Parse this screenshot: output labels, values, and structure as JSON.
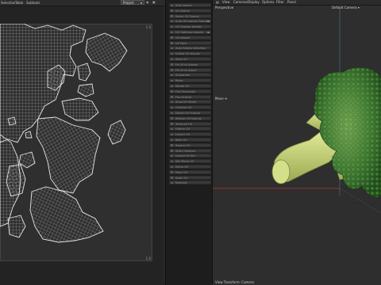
{
  "uv_editor": {
    "menu": [
      "Selection",
      "Table",
      "Subtools"
    ],
    "projection_dropdown": "Project",
    "tick_top_right": "1.0",
    "tick_bottom_right": "1.0"
  },
  "tools": [
    {
      "label": "Auto seams",
      "checked": false
    },
    {
      "label": "Un Seams",
      "checked": false
    },
    {
      "label": "Select UV Seams",
      "checked": false
    },
    {
      "label": "Auto UV Islands Projection",
      "checked": true
    },
    {
      "label": "UV Unwrap Islands",
      "checked": false
    },
    {
      "label": "UV Optimize Islands",
      "checked": true
    },
    {
      "label": "UV Islands",
      "checked": false
    },
    {
      "label": "UV Pack",
      "checked": false
    },
    {
      "label": "Auto Seams Selection",
      "checked": false
    },
    {
      "label": "Unfold UV Islands",
      "checked": false
    },
    {
      "label": "Align UV",
      "checked": false
    },
    {
      "label": "Fit UV to Islands",
      "checked": false
    },
    {
      "label": "Fit UV to Island",
      "checked": false
    },
    {
      "label": "Straighten",
      "checked": false
    },
    {
      "label": "Relax",
      "checked": false
    },
    {
      "label": "Rotate UV",
      "checked": false
    },
    {
      "label": "Flip Horizontal",
      "checked": false
    },
    {
      "label": "Flip Vertical",
      "checked": false
    },
    {
      "label": "Snap UV Shells",
      "checked": false
    },
    {
      "label": "Checker UV",
      "checked": false
    },
    {
      "label": "Distort UV Islands",
      "checked": false
    },
    {
      "label": "Relaxer UV Islands",
      "checked": false
    },
    {
      "label": "Textured UV",
      "checked": false
    },
    {
      "label": "Gather UV",
      "checked": false
    },
    {
      "label": "Layout UV",
      "checked": false
    },
    {
      "label": "Bake UV",
      "checked": false
    },
    {
      "label": "Sewing UV",
      "checked": false
    },
    {
      "label": "Stitch Vertices",
      "checked": false
    },
    {
      "label": "Layout UV Set",
      "checked": false
    },
    {
      "label": "Set Mirror UV",
      "checked": false
    },
    {
      "label": "Mirror UV",
      "checked": false
    },
    {
      "label": "Move UV",
      "checked": false
    },
    {
      "label": "Scale UV",
      "checked": false
    },
    {
      "label": "Normals",
      "checked": false
    }
  ],
  "viewport": {
    "menu": [
      "View",
      "Cameras",
      "Display",
      "Options",
      "Filter",
      "Panel"
    ],
    "view_mode": "Perspective",
    "camera": "Default Camera",
    "move_label": "Move",
    "status": "View Transform: Camera"
  },
  "colors": {
    "uv_bg": "#2f2f2f",
    "uv_wire": "#cfcfcf",
    "viewport_bg": "#2e2e2e",
    "broccoli_stem": "#c8d67a",
    "broccoli_top": "#3f7a33",
    "grid_red": "#b23a3a"
  }
}
